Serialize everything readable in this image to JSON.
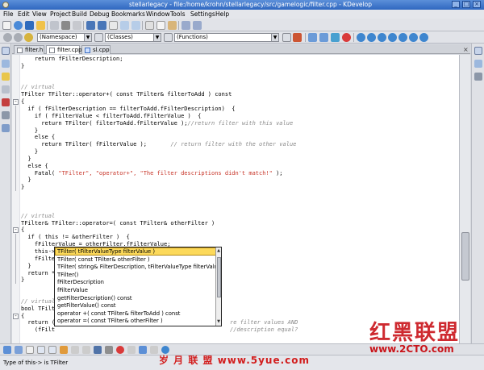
{
  "window": {
    "title": "stellarlegacy - file:/home/krohn/stellarlegacy/src/gamelogic/filter.cpp - KDevelop",
    "app_icon": "kde-gear-icon",
    "buttons": [
      "minimize",
      "maximize",
      "close"
    ]
  },
  "menu": [
    "File",
    "Edit",
    "View",
    "Project",
    "Build",
    "Debug",
    "Bookmarks",
    "Window",
    "Tools",
    "Settings",
    "Help"
  ],
  "toolbar2": {
    "namespace_combo": "(Namespace)",
    "classes_combo": "(Classes)",
    "functions_combo": "(Functions)"
  },
  "tabs": [
    {
      "label": "filter.h",
      "active": false,
      "icon": "file-icon"
    },
    {
      "label": "filter.cpp",
      "active": true,
      "icon": "file-icon"
    },
    {
      "label": "sl.cpp",
      "active": false,
      "icon": "file-blue-icon"
    }
  ],
  "code_lines": [
    {
      "text": "    return fFilterDescription;",
      "kind": "code"
    },
    {
      "text": "}",
      "kind": "code"
    },
    {
      "text": "",
      "kind": "code"
    },
    {
      "text": "",
      "kind": "code"
    },
    {
      "text": "// virtual",
      "kind": "comment"
    },
    {
      "text": "TFilter TFilter::operator+( const TFilter& filterToAdd ) const",
      "kind": "code"
    },
    {
      "text": "{",
      "kind": "code"
    },
    {
      "text": "  if ( fFilterDescription == filterToAdd.fFilterDescription)  {",
      "kind": "code"
    },
    {
      "text": "    if ( fFilterValue < filterToAdd.fFilterValue )  {",
      "kind": "code"
    },
    {
      "text": "      return TFilter( filterToAdd.fFilterValue );//return filter with this value",
      "kind": "mixed"
    },
    {
      "text": "    }",
      "kind": "code"
    },
    {
      "text": "    else {",
      "kind": "code"
    },
    {
      "text": "      return TFilter( fFilterValue );       // return filter with the other value",
      "kind": "mixed"
    },
    {
      "text": "    }",
      "kind": "code"
    },
    {
      "text": "  }",
      "kind": "code"
    },
    {
      "text": "  else {",
      "kind": "code"
    },
    {
      "text": "    Fatal( \"TFilter\", \"operator+\", \"The filter descriptions didn't match!\" );",
      "kind": "string"
    },
    {
      "text": "  }",
      "kind": "code"
    },
    {
      "text": "}",
      "kind": "code"
    },
    {
      "text": "",
      "kind": "code"
    },
    {
      "text": "",
      "kind": "code"
    },
    {
      "text": "",
      "kind": "code"
    },
    {
      "text": "// virtual",
      "kind": "comment"
    },
    {
      "text": "TFilter& TFilter::operator=( const TFilter& otherFilter )",
      "kind": "code"
    },
    {
      "text": "{",
      "kind": "code"
    },
    {
      "text": "  if ( this != &otherFilter )  {",
      "kind": "code"
    },
    {
      "text": "    fFilterValue = otherFilter.fFilterValue;",
      "kind": "code"
    },
    {
      "text": "    this->",
      "kind": "code"
    },
    {
      "text": "    fFilte",
      "kind": "code"
    },
    {
      "text": "  }",
      "kind": "code"
    },
    {
      "text": "  return *",
      "kind": "code"
    },
    {
      "text": "}",
      "kind": "code"
    },
    {
      "text": "",
      "kind": "code"
    },
    {
      "text": "",
      "kind": "code"
    },
    {
      "text": "// virtual",
      "kind": "comment"
    },
    {
      "text": "bool TFilt",
      "kind": "code"
    },
    {
      "text": "{",
      "kind": "code"
    },
    {
      "text": "  return (",
      "kind": "code"
    },
    {
      "text": "    (fFilt",
      "kind": "code"
    },
    {
      "text": "",
      "kind": "code"
    }
  ],
  "trailing_comments": [
    {
      "line": 37,
      "text": "re filter values AND"
    },
    {
      "line": 38,
      "text": "//description equal?"
    }
  ],
  "completion": {
    "items": [
      "TFilter( tFilterValueType filterValue )",
      "TFilter( const TFilter& otherFilter )",
      "TFilter( string& FilterDescription, tFilterValueType filterValue )",
      "TFilter()",
      "fFilterDescription",
      "fFilterValue",
      "getFilterDescription()  const",
      "getFilterValue()  const",
      "operator +( const TFilter& filterToAdd ) const",
      "operator =( const TFilter& otherFilter )"
    ],
    "selected_index": 0
  },
  "status": {
    "text": "Type of this-> is TFilter"
  },
  "watermarks": {
    "brand": "红黑联盟",
    "url": "www.2CTO.com",
    "cn": "岁 月 联 盟  www.5yue.com"
  },
  "colors": {
    "title_bar": "#2f67c0",
    "completion_selected": "#fcd95a",
    "watermark_red": "#c9141a",
    "comment": "#8a8a8a",
    "string": "#c8372b"
  }
}
